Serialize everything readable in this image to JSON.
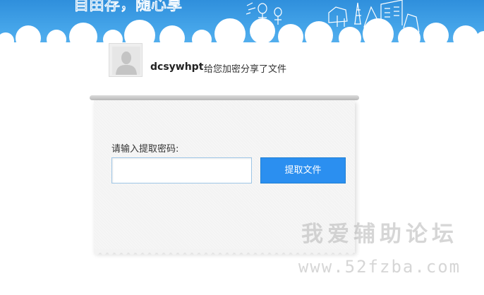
{
  "header": {
    "banner_text": "自由存，随心享"
  },
  "profile": {
    "username": "dcsywhpt",
    "share_text": "给您加密分享了文件"
  },
  "form": {
    "label": "请输入提取密码:",
    "password_value": "",
    "password_placeholder": "",
    "submit_label": "提取文件"
  },
  "watermark": {
    "site_name": "我爱辅助论坛",
    "url": "www.52fzba.com"
  },
  "colors": {
    "header_blue": "#46a6ea",
    "button_blue": "#2b8ff0",
    "input_border": "#9ec6e6"
  }
}
